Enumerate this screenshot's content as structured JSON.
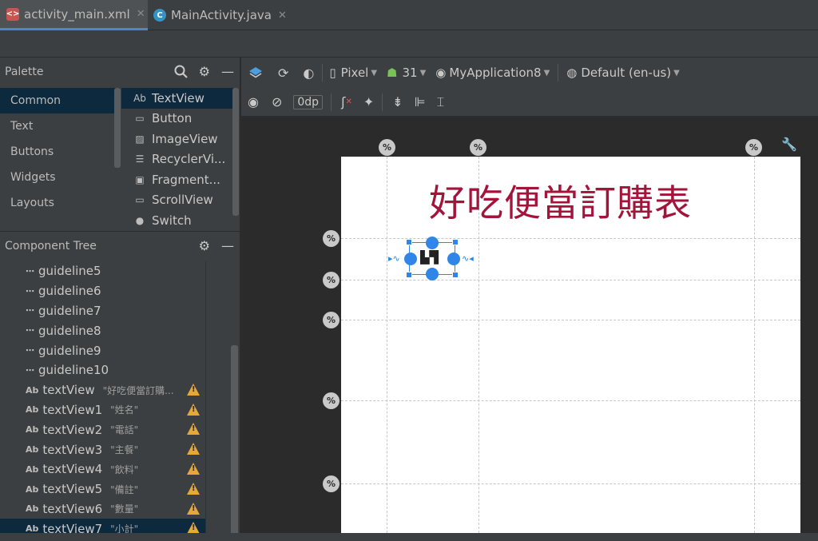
{
  "tabs": [
    {
      "label": "activity_main.xml",
      "active": true,
      "icon": "xml-layout-icon",
      "icon_color": "#c75450"
    },
    {
      "label": "MainActivity.java",
      "active": false,
      "icon": "class-icon",
      "icon_color": "#3592c4"
    }
  ],
  "palette": {
    "title": "Palette",
    "categories": [
      "Common",
      "Text",
      "Buttons",
      "Widgets",
      "Layouts"
    ],
    "selected_category": "Common",
    "widgets": [
      {
        "icon": "Ab",
        "label": "TextView"
      },
      {
        "icon": "▭",
        "label": "Button"
      },
      {
        "icon": "▨",
        "label": "ImageView"
      },
      {
        "icon": "☰",
        "label": "RecyclerVi..."
      },
      {
        "icon": "▣",
        "label": "Fragment..."
      },
      {
        "icon": "▭",
        "label": "ScrollView"
      },
      {
        "icon": "●",
        "label": "Switch"
      }
    ]
  },
  "component_tree": {
    "title": "Component Tree",
    "items": [
      {
        "icon": "⋯",
        "name": "guideline5",
        "value": "",
        "warning": false
      },
      {
        "icon": "⋯",
        "name": "guideline6",
        "value": "",
        "warning": false
      },
      {
        "icon": "⋯",
        "name": "guideline7",
        "value": "",
        "warning": false
      },
      {
        "icon": "⋯",
        "name": "guideline8",
        "value": "",
        "warning": false
      },
      {
        "icon": "⋯",
        "name": "guideline9",
        "value": "",
        "warning": false
      },
      {
        "icon": "⋯",
        "name": "guideline10",
        "value": "",
        "warning": false
      },
      {
        "icon": "Ab",
        "name": "textView",
        "value": "\"好吃便當訂購...",
        "warning": true
      },
      {
        "icon": "Ab",
        "name": "textView1",
        "value": "\"姓名\"",
        "warning": true
      },
      {
        "icon": "Ab",
        "name": "textView2",
        "value": "\"電話\"",
        "warning": true
      },
      {
        "icon": "Ab",
        "name": "textView3",
        "value": "\"主餐\"",
        "warning": true
      },
      {
        "icon": "Ab",
        "name": "textView4",
        "value": "\"飲料\"",
        "warning": true
      },
      {
        "icon": "Ab",
        "name": "textView5",
        "value": "\"備註\"",
        "warning": true
      },
      {
        "icon": "Ab",
        "name": "textView6",
        "value": "\"數量\"",
        "warning": true
      },
      {
        "icon": "Ab",
        "name": "textView7",
        "value": "\"小計\"",
        "warning": true,
        "selected": true
      }
    ]
  },
  "toolbar": {
    "device": "Pixel",
    "api": "31",
    "theme": "MyApplication8",
    "locale": "Default (en-us)",
    "margin": "0dp"
  },
  "canvas": {
    "title_text": "好吃便當訂購表",
    "title_color": "#a3143b",
    "guide_badge": "%"
  }
}
